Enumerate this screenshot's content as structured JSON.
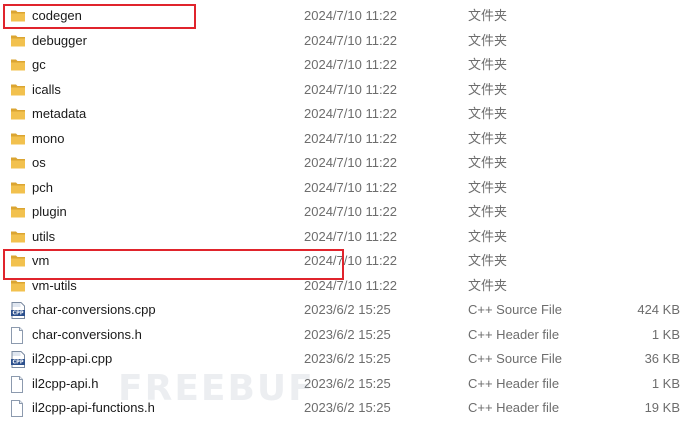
{
  "colors": {
    "folder": "#f2c14e",
    "folder_dark": "#dba532",
    "highlight": "#e0242c",
    "meta_text": "#6d6d6d"
  },
  "watermark": "FREEBUF",
  "rows": [
    {
      "name": "codegen",
      "date": "2024/7/10 11:22",
      "type": "文件夹",
      "size": "",
      "icon": "folder-icon"
    },
    {
      "name": "debugger",
      "date": "2024/7/10 11:22",
      "type": "文件夹",
      "size": "",
      "icon": "folder-icon"
    },
    {
      "name": "gc",
      "date": "2024/7/10 11:22",
      "type": "文件夹",
      "size": "",
      "icon": "folder-icon"
    },
    {
      "name": "icalls",
      "date": "2024/7/10 11:22",
      "type": "文件夹",
      "size": "",
      "icon": "folder-icon"
    },
    {
      "name": "metadata",
      "date": "2024/7/10 11:22",
      "type": "文件夹",
      "size": "",
      "icon": "folder-icon"
    },
    {
      "name": "mono",
      "date": "2024/7/10 11:22",
      "type": "文件夹",
      "size": "",
      "icon": "folder-icon"
    },
    {
      "name": "os",
      "date": "2024/7/10 11:22",
      "type": "文件夹",
      "size": "",
      "icon": "folder-icon"
    },
    {
      "name": "pch",
      "date": "2024/7/10 11:22",
      "type": "文件夹",
      "size": "",
      "icon": "folder-icon"
    },
    {
      "name": "plugin",
      "date": "2024/7/10 11:22",
      "type": "文件夹",
      "size": "",
      "icon": "folder-icon"
    },
    {
      "name": "utils",
      "date": "2024/7/10 11:22",
      "type": "文件夹",
      "size": "",
      "icon": "folder-icon"
    },
    {
      "name": "vm",
      "date": "2024/7/10 11:22",
      "type": "文件夹",
      "size": "",
      "icon": "folder-icon"
    },
    {
      "name": "vm-utils",
      "date": "2024/7/10 11:22",
      "type": "文件夹",
      "size": "",
      "icon": "folder-icon"
    },
    {
      "name": "char-conversions.cpp",
      "date": "2023/6/2 15:25",
      "type": "C++ Source File",
      "size": "424 KB",
      "icon": "cpp-file-icon"
    },
    {
      "name": "char-conversions.h",
      "date": "2023/6/2 15:25",
      "type": "C++ Header file",
      "size": "1 KB",
      "icon": "header-file-icon"
    },
    {
      "name": "il2cpp-api.cpp",
      "date": "2023/6/2 15:25",
      "type": "C++ Source File",
      "size": "36 KB",
      "icon": "cpp-file-icon"
    },
    {
      "name": "il2cpp-api.h",
      "date": "2023/6/2 15:25",
      "type": "C++ Header file",
      "size": "1 KB",
      "icon": "header-file-icon"
    },
    {
      "name": "il2cpp-api-functions.h",
      "date": "2023/6/2 15:25",
      "type": "C++ Header file",
      "size": "19 KB",
      "icon": "header-file-icon"
    }
  ]
}
